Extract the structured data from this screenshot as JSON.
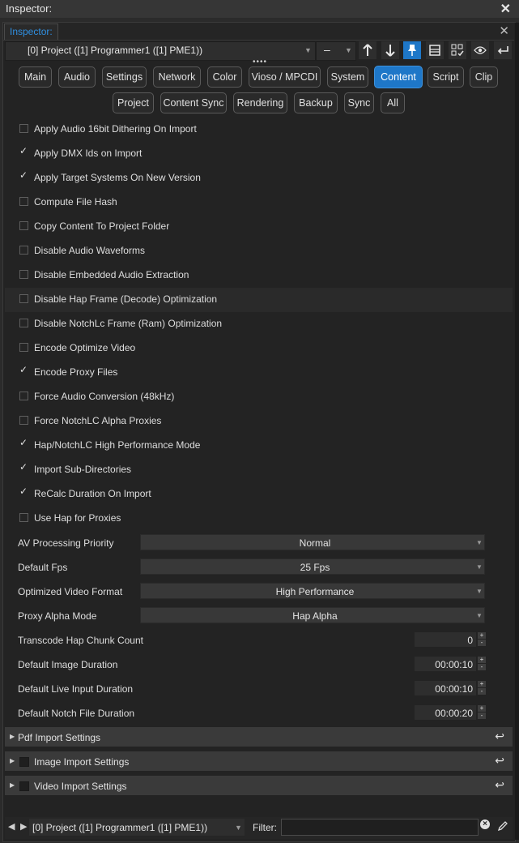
{
  "window": {
    "title": "Inspector:",
    "close_glyph": "✕"
  },
  "tab": {
    "label": "Inspector:",
    "close_glyph": "✕"
  },
  "toolbar": {
    "project": "[0] Project ([1] Programmer1 ([1] PME1))",
    "dash_value": "–",
    "drag_handle": "••••"
  },
  "categories": {
    "row1": [
      "Main",
      "Audio",
      "Settings",
      "Network",
      "Color",
      "Vioso / MPCDI",
      "System",
      "Content",
      "Script",
      "Clip"
    ],
    "row2": [
      "Project",
      "Content Sync",
      "Rendering",
      "Backup",
      "Sync",
      "All"
    ],
    "active": "Content"
  },
  "checkboxes": [
    {
      "label": "Apply Audio 16bit Dithering On Import",
      "checked": false
    },
    {
      "label": "Apply DMX Ids on Import",
      "checked": true
    },
    {
      "label": "Apply Target Systems On New Version",
      "checked": true
    },
    {
      "label": "Compute File Hash",
      "checked": false
    },
    {
      "label": "Copy Content To Project Folder",
      "checked": false
    },
    {
      "label": "Disable Audio Waveforms",
      "checked": false
    },
    {
      "label": "Disable Embedded Audio Extraction",
      "checked": false
    },
    {
      "label": "Disable Hap Frame (Decode) Optimization",
      "checked": false
    },
    {
      "label": "Disable NotchLc Frame (Ram) Optimization",
      "checked": false
    },
    {
      "label": "Encode Optimize Video",
      "checked": false
    },
    {
      "label": "Encode Proxy Files",
      "checked": true
    },
    {
      "label": "Force Audio Conversion (48kHz)",
      "checked": false
    },
    {
      "label": "Force NotchLC Alpha Proxies",
      "checked": false
    },
    {
      "label": "Hap/NotchLC High Performance Mode",
      "checked": true
    },
    {
      "label": "Import Sub-Directories",
      "checked": true
    },
    {
      "label": "ReCalc Duration On Import",
      "checked": true
    },
    {
      "label": "Use Hap for Proxies",
      "checked": false
    }
  ],
  "selects": [
    {
      "label": "AV Processing Priority",
      "value": "Normal"
    },
    {
      "label": "Default Fps",
      "value": "25 Fps"
    },
    {
      "label": "Optimized Video Format",
      "value": "High Performance"
    },
    {
      "label": "Proxy Alpha Mode",
      "value": "Hap Alpha"
    }
  ],
  "spinners": [
    {
      "label": "Transcode Hap Chunk Count",
      "value": "0"
    },
    {
      "label": "Default Image Duration",
      "value": "00:00:10"
    },
    {
      "label": "Default Live Input Duration",
      "value": "00:00:10"
    },
    {
      "label": "Default Notch File Duration",
      "value": "00:00:20"
    }
  ],
  "sections": [
    {
      "label": "Pdf Import Settings",
      "has_checkbox": false
    },
    {
      "label": "Image Import Settings",
      "has_checkbox": true
    },
    {
      "label": "Video Import Settings",
      "has_checkbox": true
    }
  ],
  "footer": {
    "project": "[0] Project ([1] Programmer1 ([1] PME1))",
    "filter_label": "Filter:",
    "filter_value": ""
  },
  "colors": {
    "accent": "#1e77c8",
    "tab_text": "#2f8fe0",
    "background": "#232323"
  }
}
